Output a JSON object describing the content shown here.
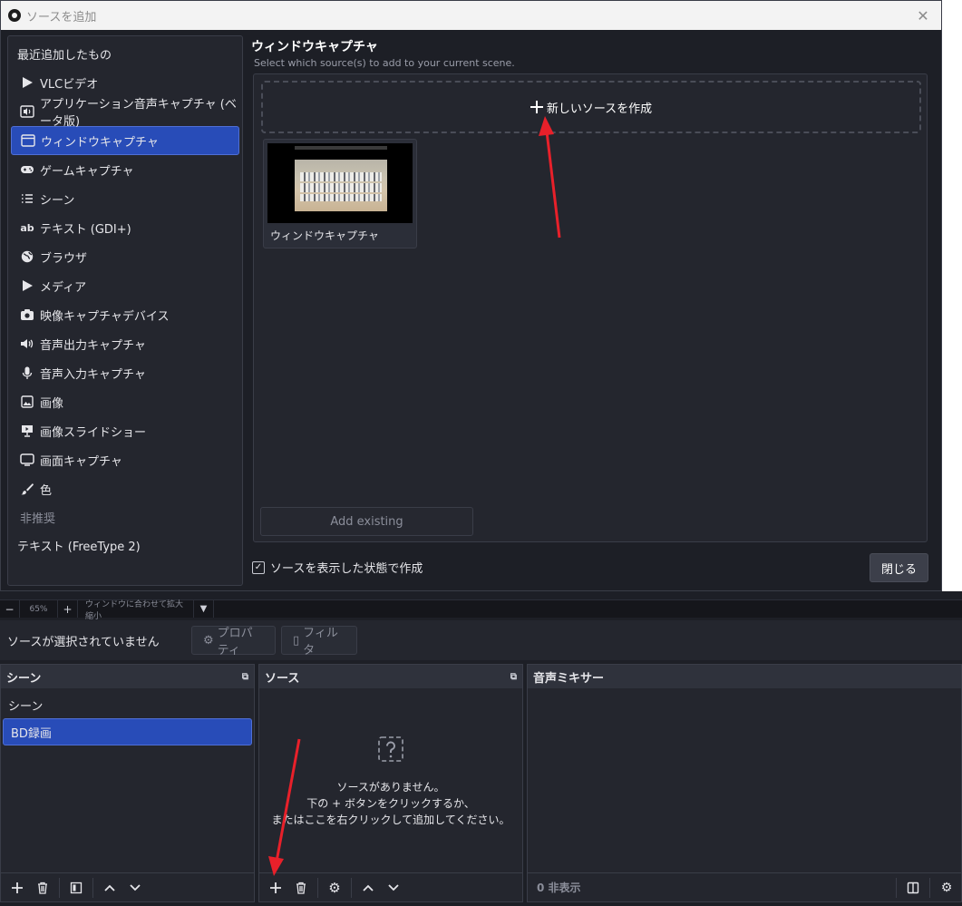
{
  "dialog": {
    "title": "ソースを追加",
    "close_glyph": "✕",
    "source_types": [
      {
        "label": "最近追加したもの",
        "icon": "none",
        "kind": "plain"
      },
      {
        "label": "VLCビデオ",
        "icon": "play-icon",
        "kind": "item"
      },
      {
        "label": "アプリケーション音声キャプチャ (ベータ版)",
        "icon": "app-audio-icon",
        "kind": "item"
      },
      {
        "label": "ウィンドウキャプチャ",
        "icon": "window-icon",
        "kind": "selected"
      },
      {
        "label": "ゲームキャプチャ",
        "icon": "gamepad-icon",
        "kind": "item"
      },
      {
        "label": "シーン",
        "icon": "list-icon",
        "kind": "item"
      },
      {
        "label": "テキスト (GDI+)",
        "icon": "text-icon",
        "kind": "item"
      },
      {
        "label": "ブラウザ",
        "icon": "globe-icon",
        "kind": "item"
      },
      {
        "label": "メディア",
        "icon": "play-icon",
        "kind": "item"
      },
      {
        "label": "映像キャプチャデバイス",
        "icon": "camera-icon",
        "kind": "item"
      },
      {
        "label": "音声出力キャプチャ",
        "icon": "speaker-icon",
        "kind": "item"
      },
      {
        "label": "音声入力キャプチャ",
        "icon": "microphone-icon",
        "kind": "item"
      },
      {
        "label": "画像",
        "icon": "image-icon",
        "kind": "item"
      },
      {
        "label": "画像スライドショー",
        "icon": "slideshow-icon",
        "kind": "item"
      },
      {
        "label": "画面キャプチャ",
        "icon": "monitor-icon",
        "kind": "item"
      },
      {
        "label": "色",
        "icon": "brush-icon",
        "kind": "item"
      },
      {
        "label": "非推奨",
        "icon": "none",
        "kind": "section"
      },
      {
        "label": "テキスト (FreeType 2)",
        "icon": "none",
        "kind": "plain"
      }
    ],
    "text_icon_glyph": "ab",
    "selected_title": "ウィンドウキャプチャ",
    "subtitle": "Select which source(s) to add to your current scene.",
    "new_source_label": "新しいソースを作成",
    "existing_source_label": "ウィンドウキャプチャ",
    "add_existing_label": "Add existing",
    "visible_checkbox_label": "ソースを表示した状態で作成",
    "visible_checked": true,
    "close_button_label": "閉じる"
  },
  "main": {
    "zoom": {
      "minus": "−",
      "level": "65%",
      "plus": "+",
      "fit_label": "ウィンドウに合わせて拡大縮小"
    },
    "context": {
      "no_source_text": "ソースが選択されていません",
      "properties_label": "プロパティ",
      "filters_label": "フィルタ"
    },
    "scenes": {
      "title": "シーン",
      "items": [
        "シーン",
        "BD録画"
      ],
      "selected_index": 1
    },
    "sources": {
      "title": "ソース",
      "empty_lines": [
        "ソースがありません。",
        "下の + ボタンをクリックするか、",
        "またはここを右クリックして追加してください。"
      ]
    },
    "mixer": {
      "title": "音声ミキサー",
      "hidden_count_label": "0 非表示"
    }
  },
  "colors": {
    "accent": "#284cb8",
    "arrow": "#e8202a",
    "background": "#1d1f26"
  }
}
